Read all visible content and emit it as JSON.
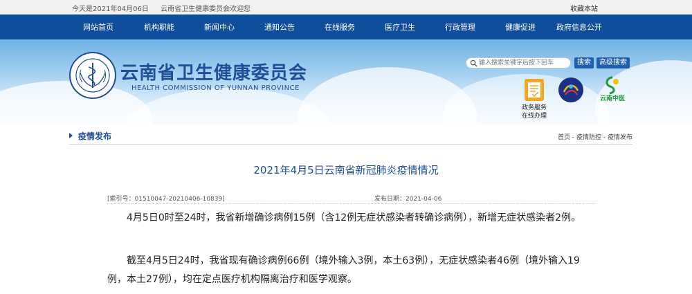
{
  "topbar": {
    "date_text": "今天是2021年04月06日",
    "welcome_text": "云南省卫生健康委员会欢迎您",
    "favorite_label": "收藏本站"
  },
  "nav": {
    "items": [
      {
        "label": "网站首页"
      },
      {
        "label": "机构职能"
      },
      {
        "label": "新闻中心"
      },
      {
        "label": "通知公告"
      },
      {
        "label": "在线服务"
      },
      {
        "label": "医疗卫生"
      },
      {
        "label": "行政管理"
      },
      {
        "label": "健康促进"
      },
      {
        "label": "政府信息公开"
      }
    ]
  },
  "header": {
    "title": "云南省卫生健康委员会",
    "subtitle": "HEALTH COMMISSION OF YUNNAN PROVINCE",
    "emblem_text": "云南省卫生健康委员会",
    "search_placeholder": "输入搜索关键字后按下回车",
    "search_button": "搜索",
    "advanced_search_button": "高级搜索",
    "services": [
      {
        "label_line1": "政务服务",
        "label_line2": "在线办理",
        "icon": "document-service-icon"
      },
      {
        "label": "",
        "icon": "health-logo-icon"
      },
      {
        "label": "云南中医",
        "icon": "tcm-logo-icon"
      }
    ]
  },
  "section": {
    "title": "疫情发布",
    "breadcrumbs": [
      "首页",
      "疫情防控",
      "疫情发布"
    ],
    "breadcrumb_separator": " - "
  },
  "article": {
    "title": "2021年4月5日云南省新冠肺炎疫情情况",
    "index_no": "[索引号：01510047-20210406-10839]",
    "publish_date": "发布日期：2021-04-06",
    "paragraphs": [
      "4月5日0时至24时，我省新增确诊病例15例（含12例无症状感染者转确诊病例），新增无症状感染者2例。",
      "截至4月5日24时，我省现有确诊病例66例（境外输入3例，本土63例），无症状感染者46例（境外输入19例，本土27例），均在定点医疗机构隔离治疗和医学观察。"
    ]
  },
  "colors": {
    "nav_bg": "#0f4e9b",
    "brand_blue": "#1f4e96",
    "button_blue": "#1f5fae"
  }
}
